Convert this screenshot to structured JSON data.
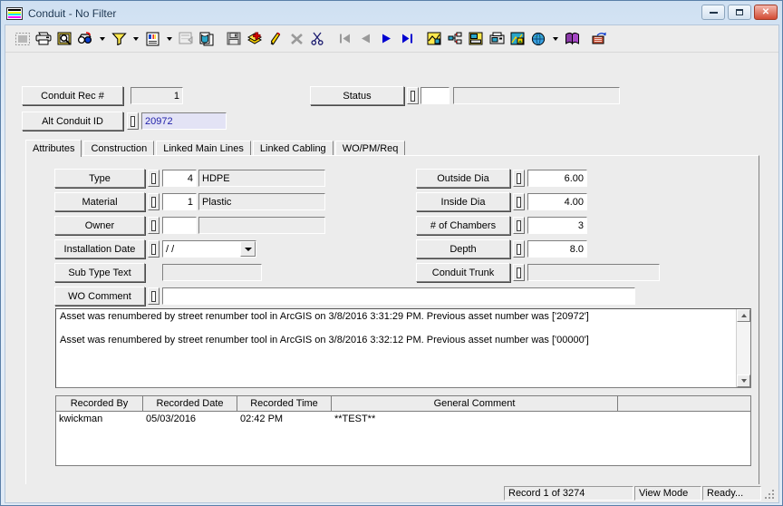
{
  "window": {
    "title": "Conduit - No Filter",
    "icon": "striped-menu-icon",
    "buttons": {
      "minimize": "minimize-icon",
      "maximize": "maximize-icon",
      "close": "close-icon"
    }
  },
  "toolbar": {
    "items": [
      {
        "name": "select-tool-icon",
        "label": "Select"
      },
      {
        "name": "print-icon",
        "label": "Print"
      },
      {
        "name": "print-preview-icon",
        "label": "Print Preview"
      },
      {
        "name": "find-icon",
        "label": "Find"
      },
      {
        "name": "find-dropdown-icon",
        "label": "Find options"
      },
      {
        "name": "filter-icon",
        "label": "Filter"
      },
      {
        "name": "filter-dropdown-icon",
        "label": "Filter options"
      },
      {
        "name": "report-icon",
        "label": "Report"
      },
      {
        "name": "report-dropdown-icon",
        "label": "Report options"
      },
      {
        "name": "form-icon",
        "label": "Form"
      },
      {
        "name": "copy-record-icon",
        "label": "Copy Record"
      },
      {
        "name": "save-icon",
        "label": "Save"
      },
      {
        "name": "add-record-icon",
        "label": "Add Record"
      },
      {
        "name": "edit-icon",
        "label": "Edit"
      },
      {
        "name": "delete-icon",
        "label": "Delete"
      },
      {
        "name": "cut-icon",
        "label": "Cut"
      },
      {
        "name": "first-record-icon",
        "label": "First"
      },
      {
        "name": "previous-record-icon",
        "label": "Previous"
      },
      {
        "name": "next-record-icon",
        "label": "Next"
      },
      {
        "name": "last-record-icon",
        "label": "Last"
      },
      {
        "name": "map-icon",
        "label": "Map"
      },
      {
        "name": "hierarchy-icon",
        "label": "Hierarchy"
      },
      {
        "name": "workorder-icon",
        "label": "Work Order"
      },
      {
        "name": "fax-icon",
        "label": "Fax"
      },
      {
        "name": "gis-icon",
        "label": "GIS"
      },
      {
        "name": "globe-icon",
        "label": "Web"
      },
      {
        "name": "globe-dropdown-icon",
        "label": "Web options"
      },
      {
        "name": "book-icon",
        "label": "Help Book"
      },
      {
        "name": "exit-icon",
        "label": "Exit"
      }
    ]
  },
  "header": {
    "rec_label": "Conduit Rec #",
    "rec_value": "1",
    "alt_label": "Alt Conduit ID",
    "alt_value": "20972",
    "status_label": "Status",
    "status_code": "",
    "status_text": ""
  },
  "tabs": [
    {
      "label": "Attributes",
      "active": true
    },
    {
      "label": "Construction",
      "active": false
    },
    {
      "label": "Linked Main Lines",
      "active": false
    },
    {
      "label": "Linked Cabling",
      "active": false
    },
    {
      "label": "WO/PM/Req",
      "active": false
    }
  ],
  "attributes": {
    "left": [
      {
        "label": "Type",
        "code": "4",
        "text": "HDPE",
        "code_white": true,
        "text_shaded": true,
        "spin": true,
        "type": "code-text"
      },
      {
        "label": "Material",
        "code": "1",
        "text": "Plastic",
        "code_white": true,
        "text_shaded": true,
        "spin": true,
        "type": "code-text"
      },
      {
        "label": "Owner",
        "code": "",
        "text": "",
        "code_white": true,
        "text_shaded": true,
        "spin": true,
        "type": "code-text"
      },
      {
        "label": "Installation Date",
        "code": "",
        "text": "/  /",
        "spin": true,
        "type": "date"
      },
      {
        "label": "Sub Type Text",
        "code": "",
        "text": "",
        "spin": false,
        "type": "text"
      },
      {
        "label": "WO Comment",
        "code": "",
        "text": "",
        "spin": true,
        "type": "wide"
      }
    ],
    "right": [
      {
        "label": "Outside Dia",
        "value": "6.00",
        "spin": true,
        "align": "right"
      },
      {
        "label": "Inside Dia",
        "value": "4.00",
        "spin": true,
        "align": "right"
      },
      {
        "label": "# of Chambers",
        "value": "3",
        "spin": true,
        "align": "right"
      },
      {
        "label": "Depth",
        "value": "8.0",
        "spin": true,
        "align": "right"
      },
      {
        "label": "Conduit Trunk",
        "value": "",
        "spin": true,
        "align": "left"
      }
    ]
  },
  "memo": {
    "lines": [
      "Asset was renumbered by street renumber tool in ArcGIS on 3/8/2016 3:31:29 PM.  Previous asset number was ['20972']",
      "",
      "Asset was renumbered by street renumber tool in ArcGIS on 3/8/2016 3:32:12 PM.  Previous asset number was ['00000']"
    ],
    "scroll_up": "scroll-up-icon",
    "scroll_down": "scroll-down-icon"
  },
  "grid": {
    "columns": [
      "Recorded By",
      "Recorded Date",
      "Recorded Time",
      "General Comment",
      ""
    ],
    "rows": [
      [
        "kwickman",
        "05/03/2016",
        "02:42 PM",
        "**TEST**",
        ""
      ]
    ]
  },
  "statusbar": {
    "record": "Record 1 of 3274",
    "mode": "View Mode",
    "state": "Ready..."
  },
  "colors": {
    "titlebar_text": "#16324f",
    "face": "#ececec",
    "alt_id_bg": "#e3e3f5",
    "alt_id_fg": "#2222aa",
    "close_button": "#d24b34"
  }
}
